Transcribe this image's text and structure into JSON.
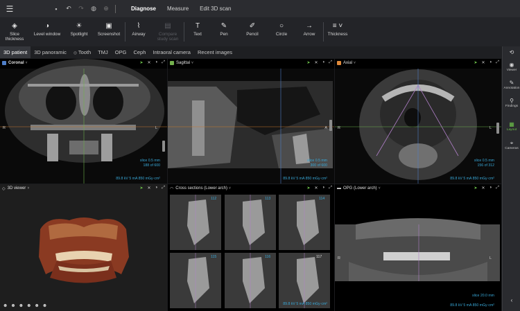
{
  "topbar": {
    "qicons": [
      "save-icon",
      "undo-icon",
      "redo-icon",
      "globe-icon",
      "help-icon"
    ],
    "nav": [
      "Diagnose",
      "Measure",
      "Edit 3D scan"
    ],
    "active_nav": 0
  },
  "toolbar": {
    "tools": [
      {
        "label": "Slice\nthickness",
        "icon": "◈",
        "name": "slice-thickness",
        "enabled": true
      },
      {
        "label": "Level window",
        "icon": "◑",
        "name": "level-window",
        "enabled": true
      },
      {
        "label": "Spotlight",
        "icon": "☀",
        "name": "spotlight",
        "enabled": true
      },
      {
        "label": "Screenshot",
        "icon": "▣",
        "name": "screenshot",
        "enabled": true
      },
      {
        "label": "Airway",
        "icon": "⌇",
        "name": "airway",
        "enabled": true
      },
      {
        "label": "Compare\nstudy scan",
        "icon": "▤",
        "name": "compare-study-scan",
        "enabled": false
      },
      {
        "label": "Text",
        "icon": "T",
        "name": "text",
        "enabled": true
      },
      {
        "label": "Pen",
        "icon": "✎",
        "name": "pen",
        "enabled": true
      },
      {
        "label": "Pencil",
        "icon": "✐",
        "name": "pencil",
        "enabled": true
      },
      {
        "label": "Circle",
        "icon": "○",
        "name": "circle",
        "enabled": true
      },
      {
        "label": "Arrow",
        "icon": "→",
        "name": "arrow",
        "enabled": true
      },
      {
        "label": "Thickness",
        "icon": "≡ ˅",
        "name": "thickness",
        "enabled": true
      }
    ]
  },
  "tabs": [
    "3D patient",
    "3D panoramic",
    "Tooth",
    "TMJ",
    "OPG",
    "Ceph",
    "Intraoral camera",
    "Recent images"
  ],
  "active_tab": 0,
  "sidebar": [
    {
      "label": "Viewer",
      "icon": "◉"
    },
    {
      "label": "Annotation",
      "icon": "✎"
    },
    {
      "label": "Findings",
      "icon": "⚲"
    },
    {
      "label": "Layout",
      "icon": "▦"
    },
    {
      "label": "Cameras",
      "icon": "⌖"
    }
  ],
  "sidebar_active": 3,
  "panels": {
    "coronal": {
      "title": "Coronal",
      "color": "#4f7fc8",
      "slice": "slice 0.5 mm",
      "pos": "188 of 600",
      "params": "89.8 kV   5 mA   850 mGy·cm²",
      "left": "R",
      "right": "L"
    },
    "sagittal": {
      "title": "Sagittal",
      "color": "#74b04d",
      "slice": "slice 0.5 mm",
      "pos": "300 of 600",
      "params": "89.8 kV   5 mA   850 mGy·cm²",
      "right": "A"
    },
    "axial": {
      "title": "Axial",
      "color": "#e08a3a",
      "slice": "slice 0.5 mm",
      "pos": "156 of 312",
      "params": "89.8 kV   5 mA   850 mGy·cm²",
      "left": "R",
      "right": "L"
    },
    "viewer3d": {
      "title": "3D viewer"
    },
    "cross": {
      "title": "Cross sections (Lower arch)",
      "numbers": [
        "112",
        "113",
        "114",
        "115",
        "116",
        "117"
      ],
      "params": "89.8 kV   5 mA   850 mGy·cm²"
    },
    "opg": {
      "title": "OPG (Lower arch)",
      "slice": "slice 20.0 mm",
      "params": "89.8 kV   5 mA   850 mGy·cm²",
      "left": "R",
      "right": "L"
    }
  }
}
